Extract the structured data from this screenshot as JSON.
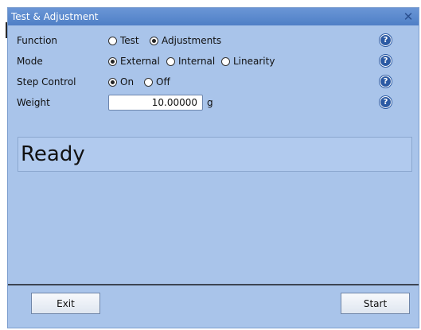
{
  "window": {
    "title": "Test & Adjustment",
    "close_glyph": "✕"
  },
  "function": {
    "label": "Function",
    "options": [
      {
        "label": "Test",
        "selected": false
      },
      {
        "label": "Adjustments",
        "selected": true
      }
    ]
  },
  "mode": {
    "label": "Mode",
    "options": [
      {
        "label": "External",
        "selected": true
      },
      {
        "label": "Internal",
        "selected": false
      },
      {
        "label": "Linearity",
        "selected": false
      }
    ]
  },
  "step_control": {
    "label": "Step Control",
    "options": [
      {
        "label": "On",
        "selected": true
      },
      {
        "label": "Off",
        "selected": false
      }
    ]
  },
  "weight": {
    "label": "Weight",
    "value": "10.00000",
    "unit": "g"
  },
  "help": {
    "glyph": "?",
    "icon": "help-icon"
  },
  "status": {
    "text": "Ready"
  },
  "buttons": {
    "exit_label": "Exit",
    "start_label": "Start"
  },
  "colors": {
    "background": "#a9c4ea",
    "titlebar": "#5a88cc",
    "help_icon": "#2c5aa3"
  }
}
